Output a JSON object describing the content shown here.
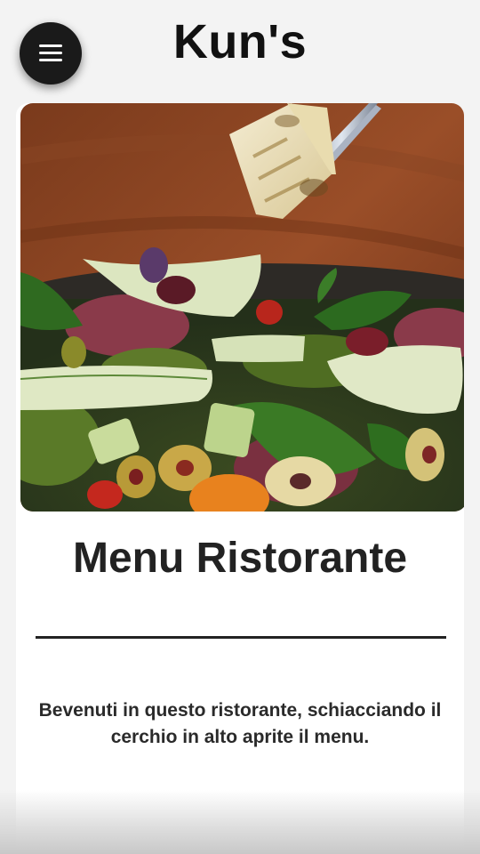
{
  "header": {
    "title": "Kun's",
    "menu_icon": "hamburger-menu-icon"
  },
  "hero_image": {
    "subject": "salad bowl with grilled halloumi held by tongs"
  },
  "card": {
    "title": "Menu Ristorante",
    "description": "Bevenuti in questo ristorante, schiacciando il cerchio in alto aprite il menu."
  },
  "colors": {
    "page_background": "#f3f3f3",
    "menu_button": "#1a1a1a",
    "text": "#222222",
    "card_background": "#ffffff"
  }
}
